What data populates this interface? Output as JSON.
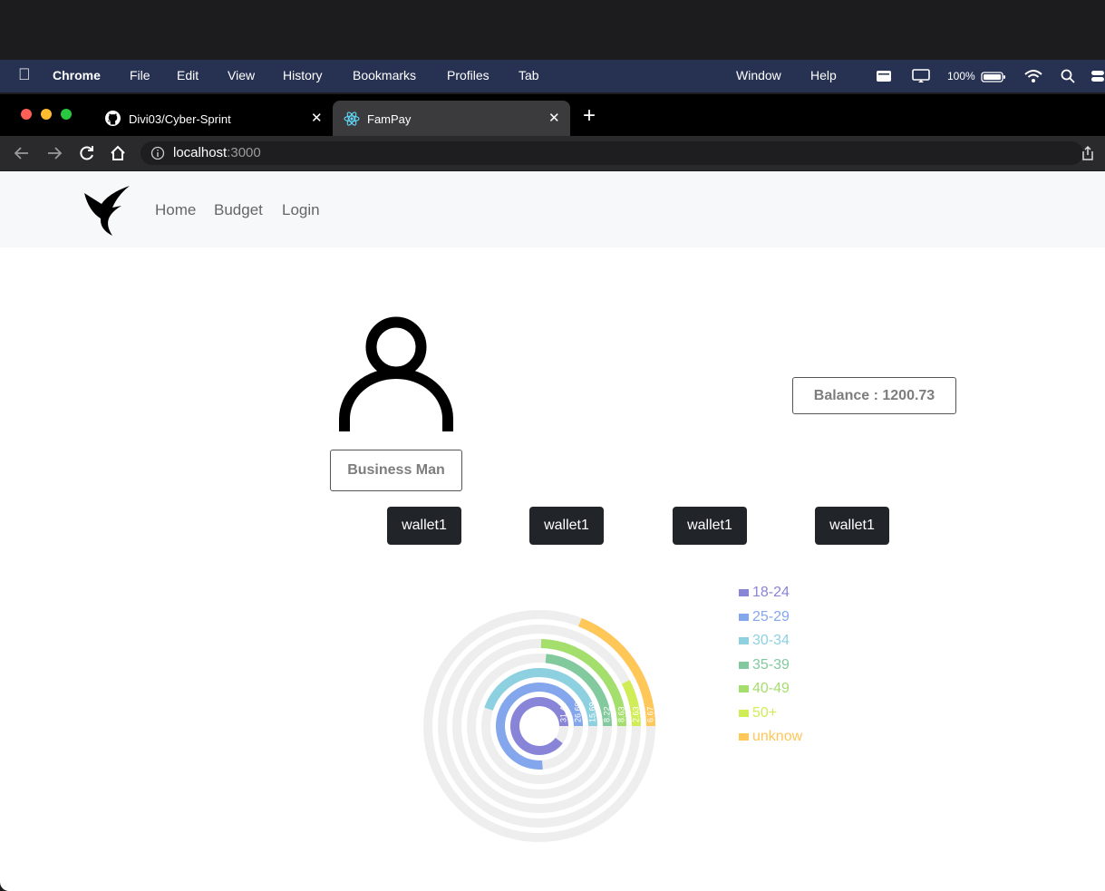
{
  "menubar": {
    "app_name": "Chrome",
    "items": [
      "File",
      "Edit",
      "View",
      "History",
      "Bookmarks",
      "Profiles",
      "Tab"
    ],
    "right_items": [
      "Window",
      "Help"
    ],
    "battery": "100%"
  },
  "tabs": [
    {
      "title": "Divi03/Cyber-Sprint",
      "icon": "github-icon"
    },
    {
      "title": "FamPay",
      "icon": "react-icon"
    }
  ],
  "address": {
    "host": "localhost",
    "port": ":3000"
  },
  "nav": {
    "links": [
      "Home",
      "Budget",
      "Login"
    ]
  },
  "profile": {
    "name": "Business Man",
    "balance": "Balance : 1200.73"
  },
  "wallets": [
    "wallet1",
    "wallet1",
    "wallet1",
    "wallet1"
  ],
  "chart_data": {
    "type": "radial-bar",
    "series": [
      {
        "name": "18-24",
        "value": 31.47,
        "color": "#8884d8"
      },
      {
        "name": "25-29",
        "value": 26.69,
        "color": "#83a6ed"
      },
      {
        "name": "30-34",
        "value": 15.69,
        "color": "#8dd1e1"
      },
      {
        "name": "35-39",
        "value": 8.22,
        "color": "#82ca9d"
      },
      {
        "name": "40-49",
        "value": 8.63,
        "color": "#a4de6c"
      },
      {
        "name": "50+",
        "value": 2.63,
        "color": "#d0ed57"
      },
      {
        "name": "unknow",
        "value": 6.67,
        "color": "#ffc658"
      }
    ],
    "legend_position": "right-top",
    "background_track": true
  }
}
